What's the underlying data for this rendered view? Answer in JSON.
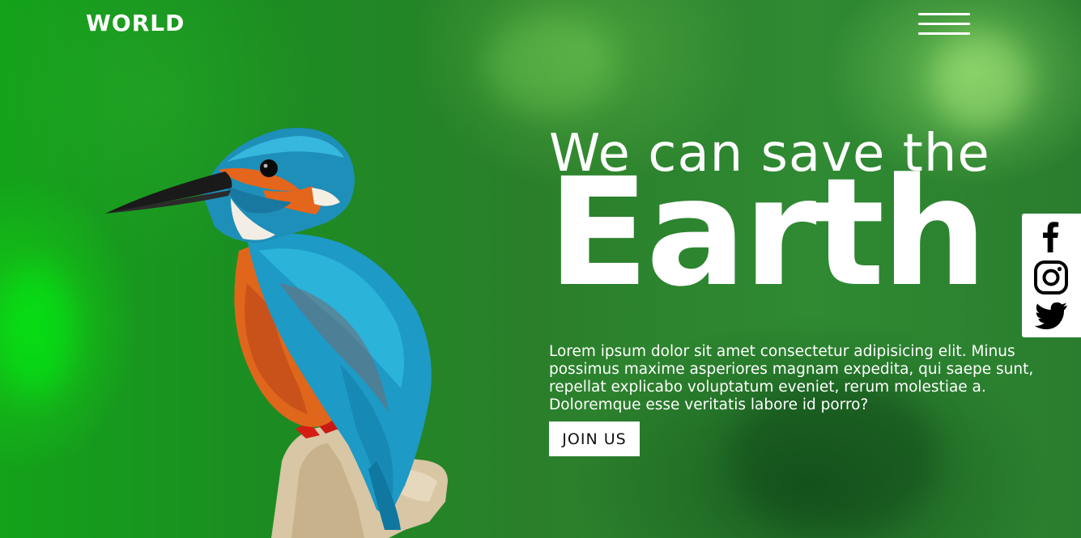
{
  "brand": {
    "logo_text": "WORLD"
  },
  "nav": {
    "menu_icon": "hamburger-menu-icon"
  },
  "hero": {
    "headline_line1": "We can save the",
    "headline_line2": "Earth",
    "description": "Lorem ipsum dolor sit amet consectetur adipisicing elit. Minus possimus maxime asperiores magnam expedita, qui saepe sunt, repellat explicabo voluptatum eveniet, rerum molestiae a. Doloremque esse veritatis labore id porro?",
    "cta_label": "JOIN US",
    "image": "kingfisher-bird-on-branch"
  },
  "social": {
    "icons": [
      "facebook-icon",
      "instagram-icon",
      "twitter-icon"
    ]
  },
  "colors": {
    "background_green": "#1c8c22",
    "text": "#ffffff",
    "bird_blue": "#1e9bc7",
    "bird_orange": "#e06a1f"
  }
}
